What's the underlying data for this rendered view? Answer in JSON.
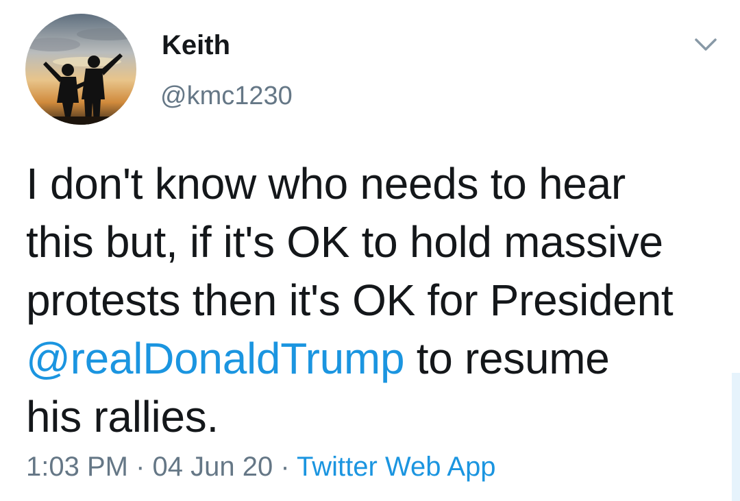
{
  "author": {
    "display_name": "Keith",
    "handle": "@kmc1230",
    "avatar_icon": "profile-photo-silhouettes"
  },
  "tweet": {
    "text_part1": "I don't know who needs to hear\nthis but, if it's OK to hold massive\nprotests then it's OK for President\n",
    "mention": "@realDonaldTrump",
    "text_part2": " to resume\nhis rallies."
  },
  "meta": {
    "time": "1:03 PM",
    "separator1": " · ",
    "date": "04 Jun 20",
    "separator2": " · ",
    "source": "Twitter Web App"
  },
  "icons": {
    "menu": "chevron-down-icon"
  },
  "colors": {
    "text": "#14171a",
    "secondary": "#657786",
    "link": "#1b95e0",
    "background": "#ffffff"
  }
}
